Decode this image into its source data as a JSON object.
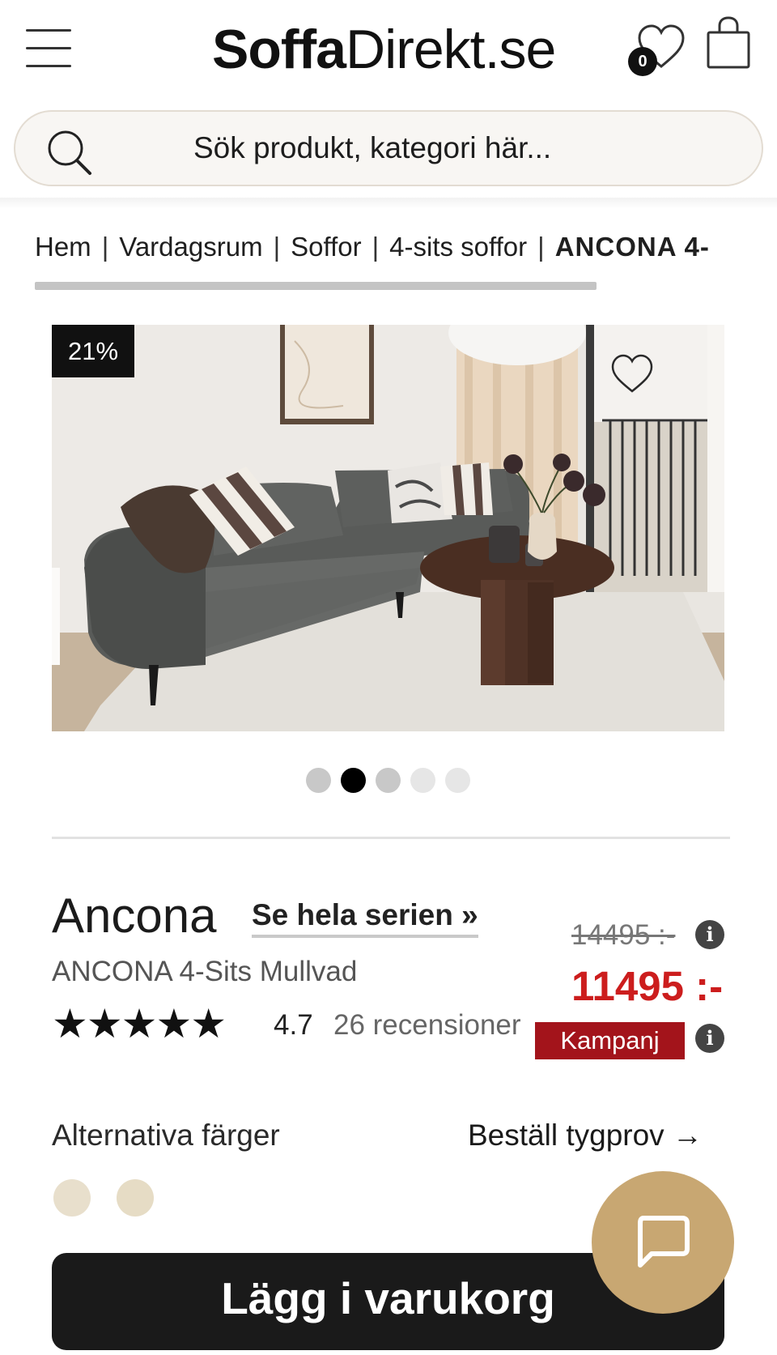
{
  "header": {
    "logo_bold": "Soffa",
    "logo_regular": "Direkt.se",
    "wishlist_count": "0"
  },
  "search": {
    "placeholder": "Sök produkt, kategori här..."
  },
  "breadcrumb": {
    "items": [
      "Hem",
      "Vardagsrum",
      "Soffor",
      "4-sits soffor"
    ],
    "current": "ANCONA 4-",
    "separator": "|"
  },
  "image": {
    "discount_badge": "21%",
    "carousel_active_index": 1,
    "carousel_dot_colors": [
      "#c8c8c8",
      "#000000",
      "#c8c8c8",
      "#e6e6e6",
      "#e6e6e6"
    ]
  },
  "product": {
    "name": "Ancona",
    "series_link": "Se hela serien »",
    "subtitle": "ANCONA 4-Sits Mullvad",
    "stars": "★★★★★",
    "rating": "4.7",
    "reviews": "26 recensioner",
    "old_price": "14495 :-",
    "price": "11495 :-",
    "campaign_label": "Kampanj",
    "info_symbol": "i"
  },
  "options": {
    "alt_colors_label": "Alternativa färger",
    "fabric_sample_label": "Beställ tygprov",
    "fabric_arrow": "→",
    "swatches": [
      "#e8dfcc",
      "#e6dcc5"
    ]
  },
  "actions": {
    "add_to_cart": "Lägg i varukorg"
  },
  "colors": {
    "price_red": "#cc1d1d",
    "campaign_bg": "#a3141b",
    "chat_bg": "#c8a772",
    "button_bg": "#1a1a1a"
  }
}
